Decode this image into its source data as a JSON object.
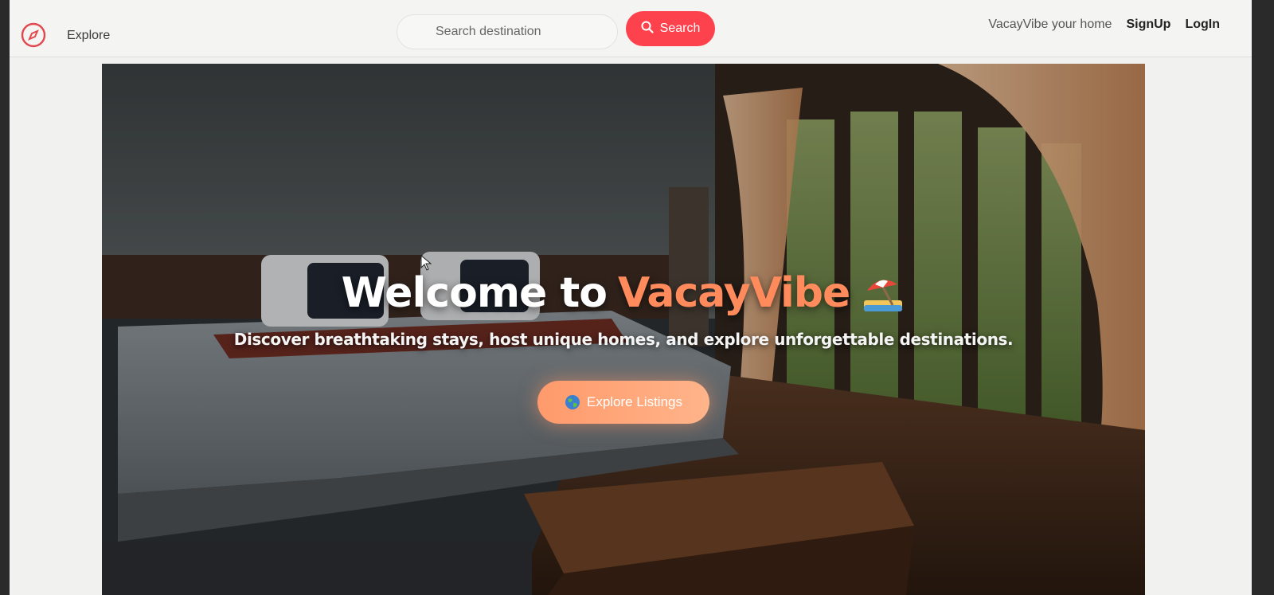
{
  "navbar": {
    "explore_label": "Explore",
    "search_placeholder": "Search destination",
    "search_button_label": "Search",
    "host_link": "VacayVibe your home",
    "signup_link": "SignUp",
    "login_link": "LogIn"
  },
  "hero": {
    "title_prefix": "Welcome to",
    "title_brand": "VacayVibe",
    "title_icon": "beach-umbrella-icon",
    "subtitle": "Discover breathtaking stays, host unique homes, and explore unforgettable destinations.",
    "cta_icon": "globe-icon",
    "cta_label": "Explore Listings"
  },
  "colors": {
    "brand": "#fe424d",
    "accent": "#ff8a5c",
    "cta": "#ff9a6b"
  },
  "icons": {
    "logo": "compass-icon",
    "search": "search-icon"
  }
}
